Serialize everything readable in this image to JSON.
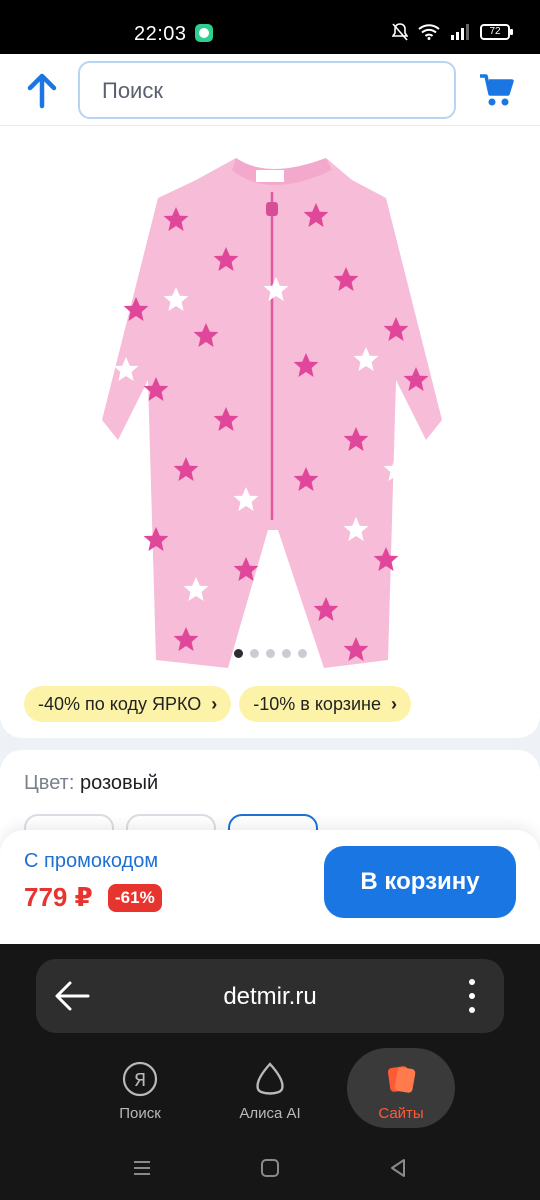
{
  "status_bar": {
    "time": "22:03",
    "battery": "72"
  },
  "search": {
    "placeholder": "Поиск"
  },
  "gallery": {
    "image_alt": "Комбинезон розовый со звёздами",
    "dots_total": 5,
    "dots_active": 1
  },
  "promos": [
    {
      "label": "-40% по коду ЯРКО"
    },
    {
      "label": "-10% в корзине"
    }
  ],
  "color": {
    "key": "Цвет",
    "value": "розовый"
  },
  "buy": {
    "promo_label": "С промокодом",
    "price": "779 ₽",
    "discount": "-61%",
    "cart_button": "В корзину"
  },
  "browser": {
    "url": "detmir.ru",
    "tabs": [
      {
        "label": "Поиск",
        "icon": "yandex-icon"
      },
      {
        "label": "Алиса AI",
        "icon": "alice-icon"
      },
      {
        "label": "Сайты",
        "icon": "sites-icon"
      }
    ]
  },
  "colors": {
    "accent": "#1a76e3",
    "price": "#e8342e",
    "promo_bg": "#fdf3a8"
  }
}
